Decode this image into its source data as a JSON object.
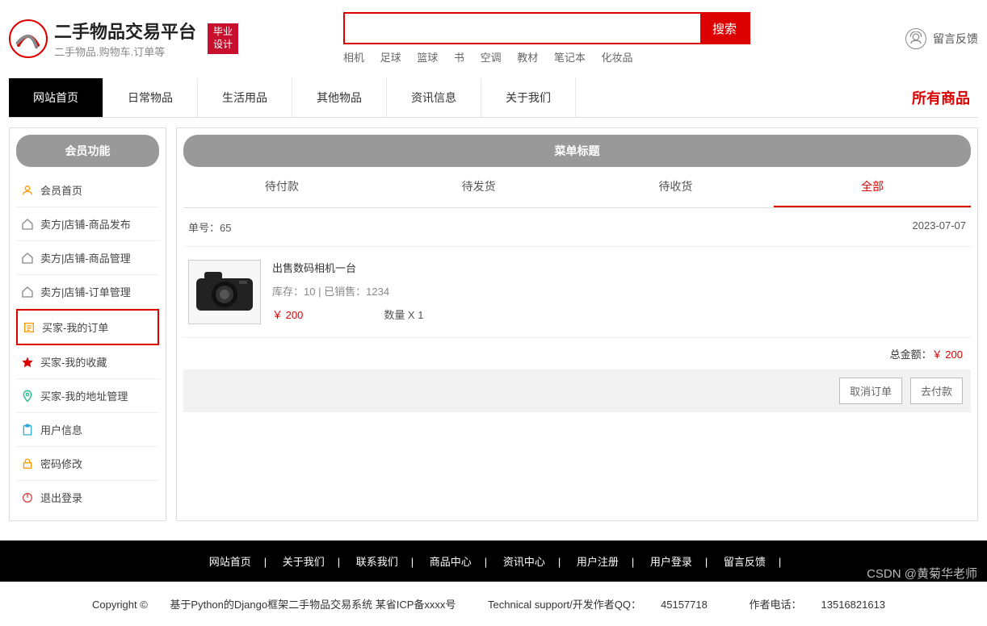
{
  "header": {
    "logo_title": "二手物品交易平台",
    "logo_subtitle": "二手物品.购物车.订单等",
    "badge_line1": "毕业",
    "badge_line2": "设计",
    "search_button": "搜索",
    "hot_words": [
      "相机",
      "足球",
      "篮球",
      "书",
      "空调",
      "教材",
      "笔记本",
      "化妆品"
    ],
    "feedback": "留言反馈"
  },
  "nav": {
    "items": [
      "网站首页",
      "日常物品",
      "生活用品",
      "其他物品",
      "资讯信息",
      "关于我们"
    ],
    "all_products": "所有商品"
  },
  "sidebar": {
    "title": "会员功能",
    "items": [
      {
        "label": "会员首页",
        "color": "#f90"
      },
      {
        "label": "卖方|店铺-商品发布",
        "color": "#888"
      },
      {
        "label": "卖方|店铺-商品管理",
        "color": "#888"
      },
      {
        "label": "卖方|店铺-订单管理",
        "color": "#888"
      },
      {
        "label": "买家-我的订单",
        "color": "#f90",
        "selected": true
      },
      {
        "label": "买家-我的收藏",
        "color": "#d00"
      },
      {
        "label": "买家-我的地址管理",
        "color": "#2b8"
      },
      {
        "label": "用户信息",
        "color": "#3ad"
      },
      {
        "label": "密码修改",
        "color": "#f90"
      },
      {
        "label": "退出登录",
        "color": "#d44"
      }
    ]
  },
  "content": {
    "menu_title": "菜单标题",
    "tabs": [
      "待付款",
      "待发货",
      "待收货",
      "全部"
    ],
    "active_tab": 3,
    "order": {
      "order_no_label": "单号：",
      "order_no": "65",
      "date": "2023-07-07",
      "product_name": "出售数码相机一台",
      "stock_label": "库存：",
      "stock": "10",
      "sold_label": "已销售：",
      "sold": "1234",
      "price": "￥ 200",
      "qty_label": "数量 X ",
      "qty": "1",
      "total_label": "总金额：",
      "total": "￥ 200",
      "cancel_btn": "取消订单",
      "pay_btn": "去付款"
    }
  },
  "footer": {
    "links": [
      "网站首页",
      "关于我们",
      "联系我们",
      "商品中心",
      "资讯中心",
      "用户注册",
      "用户登录",
      "留言反馈"
    ],
    "copyright_prefix": "Copyright © ",
    "copyright_text": "基于Python的Django框架二手物品交易系统 某省ICP备xxxx号",
    "tech_label": "Technical support/开发作者QQ：",
    "tech_qq": "45157718",
    "phone_label": "作者电话：",
    "phone": "13516821613"
  },
  "watermark": "CSDN @黄菊华老师"
}
